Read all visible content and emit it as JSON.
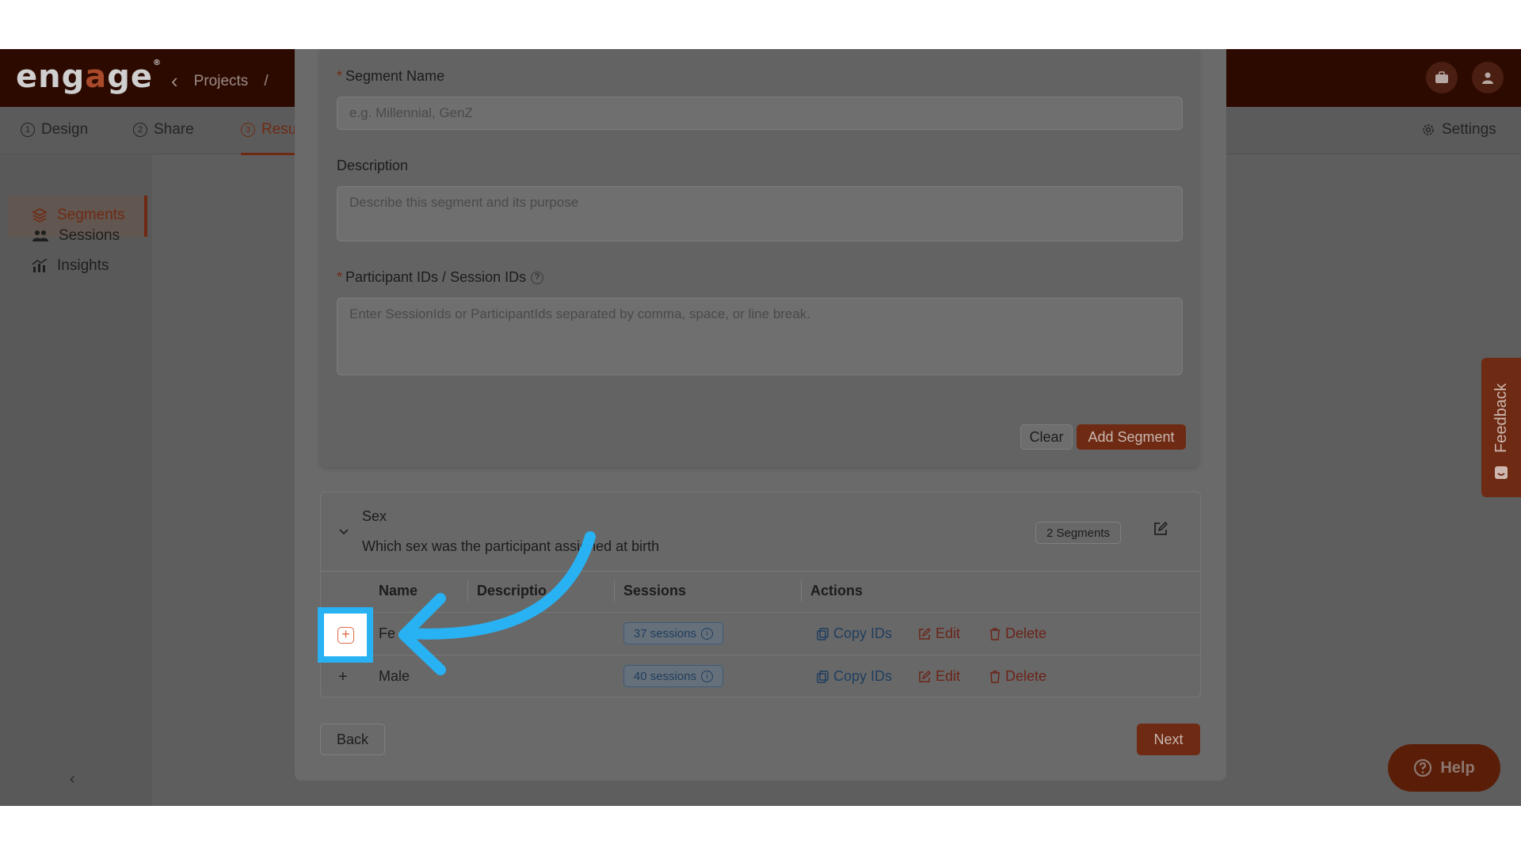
{
  "app": {
    "logo_prefix": "eng",
    "logo_mid": "a",
    "logo_suffix": "ge",
    "logo_mark": "®",
    "back_glyph": "‹",
    "nav_projects": "Projects",
    "nav_sep": "/"
  },
  "tabs": [
    {
      "num": "1",
      "label": "Design"
    },
    {
      "num": "2",
      "label": "Share"
    },
    {
      "num": "3",
      "label": "Resu"
    }
  ],
  "settings_label": "Settings",
  "sidebar": {
    "items": [
      {
        "label": "Sessions",
        "icon": "users-icon"
      },
      {
        "label": "Segments",
        "icon": "layers-icon"
      },
      {
        "label": "Insights",
        "icon": "chart-icon"
      }
    ],
    "collapse_glyph": "‹"
  },
  "form": {
    "segment_name_label": "Segment Name",
    "segment_name_placeholder": "e.g. Millennial, GenZ",
    "description_label": "Description",
    "description_placeholder": "Describe this segment and its purpose",
    "ids_label": "Participant IDs / Session IDs",
    "ids_placeholder": "Enter SessionIds or ParticipantIds separated by comma, space, or line break.",
    "required_mark": "*",
    "clear_label": "Clear",
    "add_label": "Add Segment"
  },
  "group": {
    "title": "Sex",
    "subtitle": "Which sex was the participant assigned at birth",
    "badge": "2 Segments",
    "columns": [
      "Name",
      "Descriptio",
      "Sessions",
      "Actions"
    ],
    "rows": [
      {
        "name": "Fe",
        "sessions": "37 sessions",
        "copy": "Copy IDs",
        "edit": "Edit",
        "delete": "Delete"
      },
      {
        "name": "Male",
        "sessions": "40 sessions",
        "copy": "Copy IDs",
        "edit": "Edit",
        "delete": "Delete"
      }
    ]
  },
  "footer": {
    "back": "Back",
    "next": "Next"
  },
  "feedback_label": "Feedback",
  "help_label": "Help",
  "colors": {
    "brand": "#6e2a12",
    "highlight": "#28b2f3",
    "link": "#1f3e5f"
  }
}
